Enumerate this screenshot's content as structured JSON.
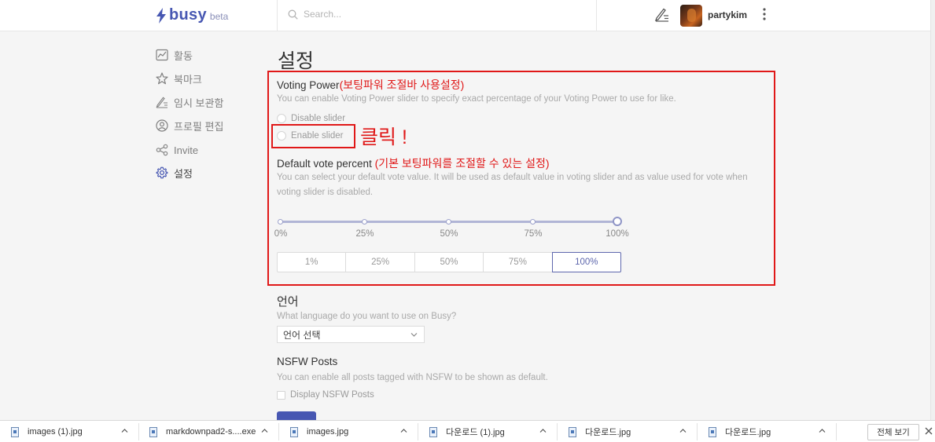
{
  "header": {
    "logo_text": "busy",
    "logo_badge": "beta",
    "search_placeholder": "Search...",
    "username": "partykim"
  },
  "sidebar": {
    "items": [
      {
        "label": "활동",
        "icon": "activity-chart-icon"
      },
      {
        "label": "북마크",
        "icon": "star-icon"
      },
      {
        "label": "임시 보관함",
        "icon": "drafts-pen-icon"
      },
      {
        "label": "프로필 편집",
        "icon": "profile-icon"
      },
      {
        "label": "Invite",
        "icon": "share-icon"
      },
      {
        "label": "설정",
        "icon": "gear-icon"
      }
    ]
  },
  "main": {
    "page_title": "설정",
    "voting_power": {
      "title": "Voting Power",
      "note": "(보팅파워 조절바 사용설정)",
      "description": "You can enable Voting Power slider to specify exact percentage of your Voting Power to use for like.",
      "options": [
        "Disable slider",
        "Enable slider"
      ]
    },
    "click_annotation": "클릭 !",
    "default_vote": {
      "title": "Default vote percent",
      "note": "(기본 보팅파워를 조절할 수 있는 설정)",
      "description_line1": "You can select your default vote value. It will be used as default value in voting slider and as value used for vote when",
      "description_line2": "voting slider is disabled.",
      "slider_labels": [
        "0%",
        "25%",
        "50%",
        "75%",
        "100%"
      ],
      "slider_value_percent": 100,
      "presets": [
        "1%",
        "25%",
        "50%",
        "75%",
        "100%"
      ],
      "selected_preset": "100%"
    },
    "language": {
      "title": "언어",
      "description": "What language do you want to use on Busy?",
      "select_value": "언어 선택"
    },
    "nsfw": {
      "title": "NSFW Posts",
      "description": "You can enable all posts tagged with NSFW to be shown as default.",
      "checkbox_label": "Display NSFW Posts"
    }
  },
  "download_bar": {
    "items": [
      "images (1).jpg",
      "markdownpad2-s....exe",
      "images.jpg",
      "다운로드 (1).jpg",
      "다운로드.jpg",
      "다운로드.jpg"
    ],
    "show_all": "전체 보기"
  },
  "colors": {
    "brand": "#4757b2",
    "annotation_red": "#e01818"
  }
}
